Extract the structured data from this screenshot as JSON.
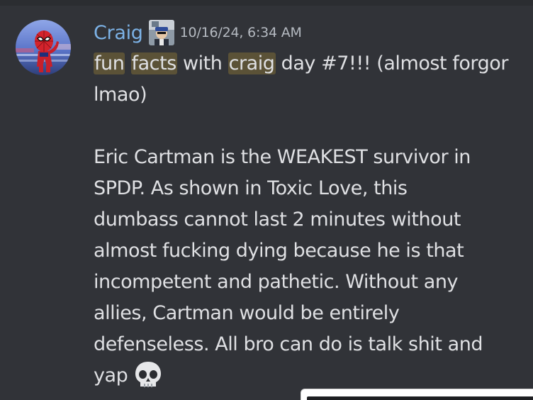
{
  "message": {
    "username": "Craig",
    "timestamp": "10/16/24, 6:34 AM",
    "avatar_icon": "spider-man-avatar",
    "role_icon": "craig-photo-icon",
    "highlight_color": "#5b5237",
    "username_color": "#7cb2e6",
    "line1": {
      "w1": "fun",
      "w2": "facts",
      "w3": "with",
      "w4": "craig",
      "rest": "day #7!!! (almost forgor"
    },
    "line2": "lmao)",
    "paragraph": [
      "Eric Cartman is the WEAKEST survivor in",
      "SPDP. As shown in Toxic Love, this",
      "dumbass cannot last 2 minutes without",
      "almost fucking dying because he is that",
      "incompetent and pathetic. Without any",
      "allies, Cartman would be entirely",
      "defenseless. All bro can do is talk shit and"
    ],
    "last_line": "yap",
    "emoji": "skull-emoji"
  }
}
